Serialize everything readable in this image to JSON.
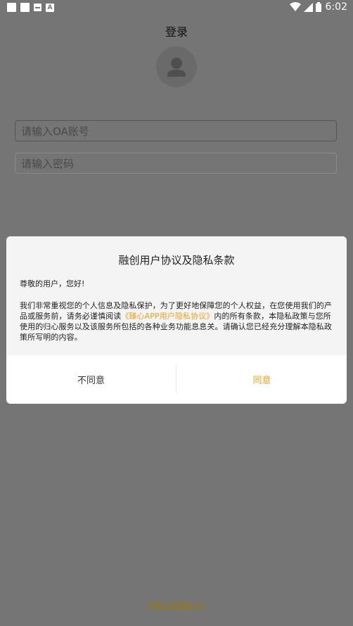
{
  "status_bar": {
    "time": "6:02"
  },
  "header": {
    "title": "登录"
  },
  "login_form": {
    "account_placeholder": "请输入OA账号",
    "password_placeholder": "请输入密码"
  },
  "footer": {
    "outside_login_link": "外部人员登录入口"
  },
  "dialog": {
    "title": "融创用户协议及隐私条款",
    "greeting": "尊敬的用户，您好!",
    "body_before_link": "我们非常重视您的个人信息及隐私保护，为了更好地保障您的个人权益，在您使用我们的产品或服务前，请务必谨慎阅读",
    "link_text": "《臻心APP用户隐私协议》",
    "body_after_link": "内的所有条款，本隐私政策与您所使用的归心服务以及该服务所包括的各种业务功能息息关。请确认您已经充分理解本隐私政策所写明的内容。",
    "disagree_label": "不同意",
    "agree_label": "同意"
  },
  "colors": {
    "accent": "#f0a020",
    "overlay": "#757575"
  }
}
